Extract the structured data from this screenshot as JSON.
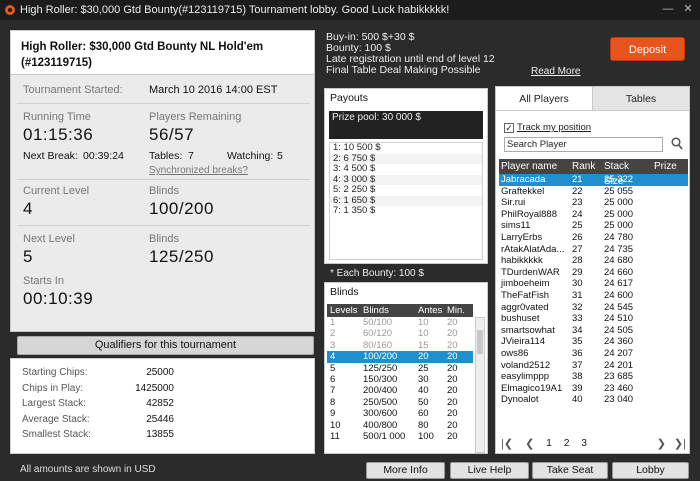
{
  "window": {
    "title": "High Roller: $30,000 Gtd Bounty(#123119715) Tournament lobby. Good Luck habikkkkk!"
  },
  "header": {
    "title": "High Roller: $30,000 Gtd Bounty NL Hold'em (#123119715)"
  },
  "info": {
    "started_label": "Tournament Started:",
    "started_value": "March 10 2016   14:00 EST",
    "running_label": "Running Time",
    "running_value": "01:15:36",
    "players_label": "Players Remaining",
    "players_value": "56/57",
    "next_break_label": "Next Break:",
    "next_break_value": "00:39:24",
    "tables_label": "Tables:",
    "tables_value": "7",
    "watching_label": "Watching:",
    "watching_value": "5",
    "sync_breaks": "Synchronized breaks?",
    "current_level_label": "Current Level",
    "current_level_value": "4",
    "blinds_label": "Blinds",
    "blinds_value": "100/200",
    "next_level_label": "Next Level",
    "next_level_value": "5",
    "next_blinds_label": "Blinds",
    "next_blinds_value": "125/250",
    "starts_in_label": "Starts In",
    "starts_in_value": "00:10:39"
  },
  "qualifiers_button": "Qualifiers for this tournament",
  "stats": [
    {
      "label": "Starting Chips:",
      "value": "25000"
    },
    {
      "label": "Chips in Play:",
      "value": "1425000"
    },
    {
      "label": "Largest Stack:",
      "value": "42852"
    },
    {
      "label": "Average Stack:",
      "value": "25446"
    },
    {
      "label": "Smallest Stack:",
      "value": "13855"
    }
  ],
  "footer_note": "All amounts are shown in USD",
  "buyin": {
    "line1": "Buy-in: 500 $+30 $",
    "line2": "Bounty: 100 $",
    "line3": "Late registration until end of level 12",
    "line4": "Final Table Deal Making Possible",
    "read_more": "Read More"
  },
  "deposit_button": "Deposit",
  "payouts": {
    "title": "Payouts",
    "prize_pool": "Prize pool: 30 000 $",
    "items": [
      "1: 10 500 $",
      "2: 6 750 $",
      "3: 4 500 $",
      "4: 3 000 $",
      "5: 2 250 $",
      "6: 1 650 $",
      "7: 1 350 $"
    ]
  },
  "bounty_note": "* Each Bounty: 100 $",
  "blinds": {
    "title": "Blinds",
    "columns": [
      "Levels",
      "Blinds",
      "Antes",
      "Min."
    ],
    "rows": [
      [
        "1",
        "50/100",
        "10",
        "20"
      ],
      [
        "2",
        "60/120",
        "10",
        "20"
      ],
      [
        "3",
        "80/160",
        "15",
        "20"
      ],
      [
        "4",
        "100/200",
        "20",
        "20"
      ],
      [
        "5",
        "125/250",
        "25",
        "20"
      ],
      [
        "6",
        "150/300",
        "30",
        "20"
      ],
      [
        "7",
        "200/400",
        "40",
        "20"
      ],
      [
        "8",
        "250/500",
        "50",
        "20"
      ],
      [
        "9",
        "300/600",
        "60",
        "20"
      ],
      [
        "10",
        "400/800",
        "80",
        "20"
      ],
      [
        "11",
        "500/1 000",
        "100",
        "20"
      ]
    ]
  },
  "players": {
    "tab_all": "All Players",
    "tab_tables": "Tables",
    "track_label": "Track my position",
    "search_value": "Search Player",
    "columns": [
      "Player name",
      "Rank",
      "Stack Size",
      "Prize"
    ],
    "rows": [
      [
        "Jabracada",
        "21",
        "25 322"
      ],
      [
        "Graftekkel",
        "22",
        "25 055"
      ],
      [
        "Sir.rui",
        "23",
        "25 000"
      ],
      [
        "PhilRoyal888",
        "24",
        "25 000"
      ],
      [
        "sims11",
        "25",
        "25 000"
      ],
      [
        "LarryErbs",
        "26",
        "24 780"
      ],
      [
        "rAtakAlatAda...",
        "27",
        "24 735"
      ],
      [
        "habikkkkk",
        "28",
        "24 680"
      ],
      [
        "TDurdenWAR",
        "29",
        "24 660"
      ],
      [
        "jimboeheim",
        "30",
        "24 617"
      ],
      [
        "TheFatFish",
        "31",
        "24 600"
      ],
      [
        "aggr0vated",
        "32",
        "24 545"
      ],
      [
        "bushuset",
        "33",
        "24 510"
      ],
      [
        "smartsowhat",
        "34",
        "24 505"
      ],
      [
        "JVieira114",
        "35",
        "24 360"
      ],
      [
        "ows86",
        "36",
        "24 207"
      ],
      [
        "voland2512",
        "37",
        "24 201"
      ],
      [
        "easylimppp",
        "38",
        "23 685"
      ],
      [
        "Elmagico19A1",
        "39",
        "23 460"
      ],
      [
        "Dynoalot",
        "40",
        "23 040"
      ]
    ],
    "pages": [
      "1",
      "2",
      "3"
    ]
  },
  "bottom_buttons": [
    "More Info",
    "Live Help",
    "Take Seat",
    "Lobby"
  ]
}
